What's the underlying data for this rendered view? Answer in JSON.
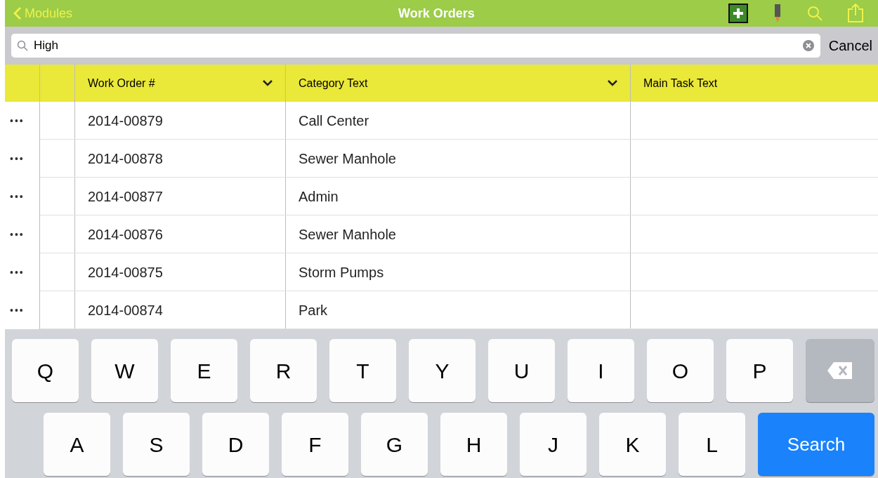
{
  "nav_bar": {
    "back_label": "Modules",
    "title": "Work Orders"
  },
  "search": {
    "value": "High",
    "cancel": "Cancel"
  },
  "table": {
    "columns": [
      {
        "label": "Work Order #",
        "sortable": true
      },
      {
        "label": "Category Text",
        "sortable": true
      },
      {
        "label": "Main Task Text",
        "sortable": false
      }
    ],
    "rows": [
      {
        "more": "•••",
        "work_order": "2014-00879",
        "category": "Call Center"
      },
      {
        "more": "•••",
        "work_order": "2014-00878",
        "category": "Sewer Manhole"
      },
      {
        "more": "•••",
        "work_order": "2014-00877",
        "category": "Admin"
      },
      {
        "more": "•••",
        "work_order": "2014-00876",
        "category": "Sewer Manhole"
      },
      {
        "more": "•••",
        "work_order": "2014-00875",
        "category": "Storm Pumps"
      },
      {
        "more": "•••",
        "work_order": "2014-00874",
        "category": "Park"
      }
    ]
  },
  "keyboard": {
    "rows": [
      [
        {
          "kind": "letter",
          "label": "Q"
        },
        {
          "kind": "letter",
          "label": "W"
        },
        {
          "kind": "letter",
          "label": "E"
        },
        {
          "kind": "letter",
          "label": "R"
        },
        {
          "kind": "letter",
          "label": "T"
        },
        {
          "kind": "letter",
          "label": "Y"
        },
        {
          "kind": "letter",
          "label": "U"
        },
        {
          "kind": "letter",
          "label": "I"
        },
        {
          "kind": "letter",
          "label": "O"
        },
        {
          "kind": "letter",
          "label": "P"
        },
        {
          "kind": "backspace"
        }
      ],
      [
        {
          "kind": "letter",
          "label": "A"
        },
        {
          "kind": "letter",
          "label": "S"
        },
        {
          "kind": "letter",
          "label": "D"
        },
        {
          "kind": "letter",
          "label": "F"
        },
        {
          "kind": "letter",
          "label": "G"
        },
        {
          "kind": "letter",
          "label": "H"
        },
        {
          "kind": "letter",
          "label": "J"
        },
        {
          "kind": "letter",
          "label": "K"
        },
        {
          "kind": "letter",
          "label": "L"
        },
        {
          "kind": "action",
          "label": "Search"
        }
      ]
    ]
  }
}
